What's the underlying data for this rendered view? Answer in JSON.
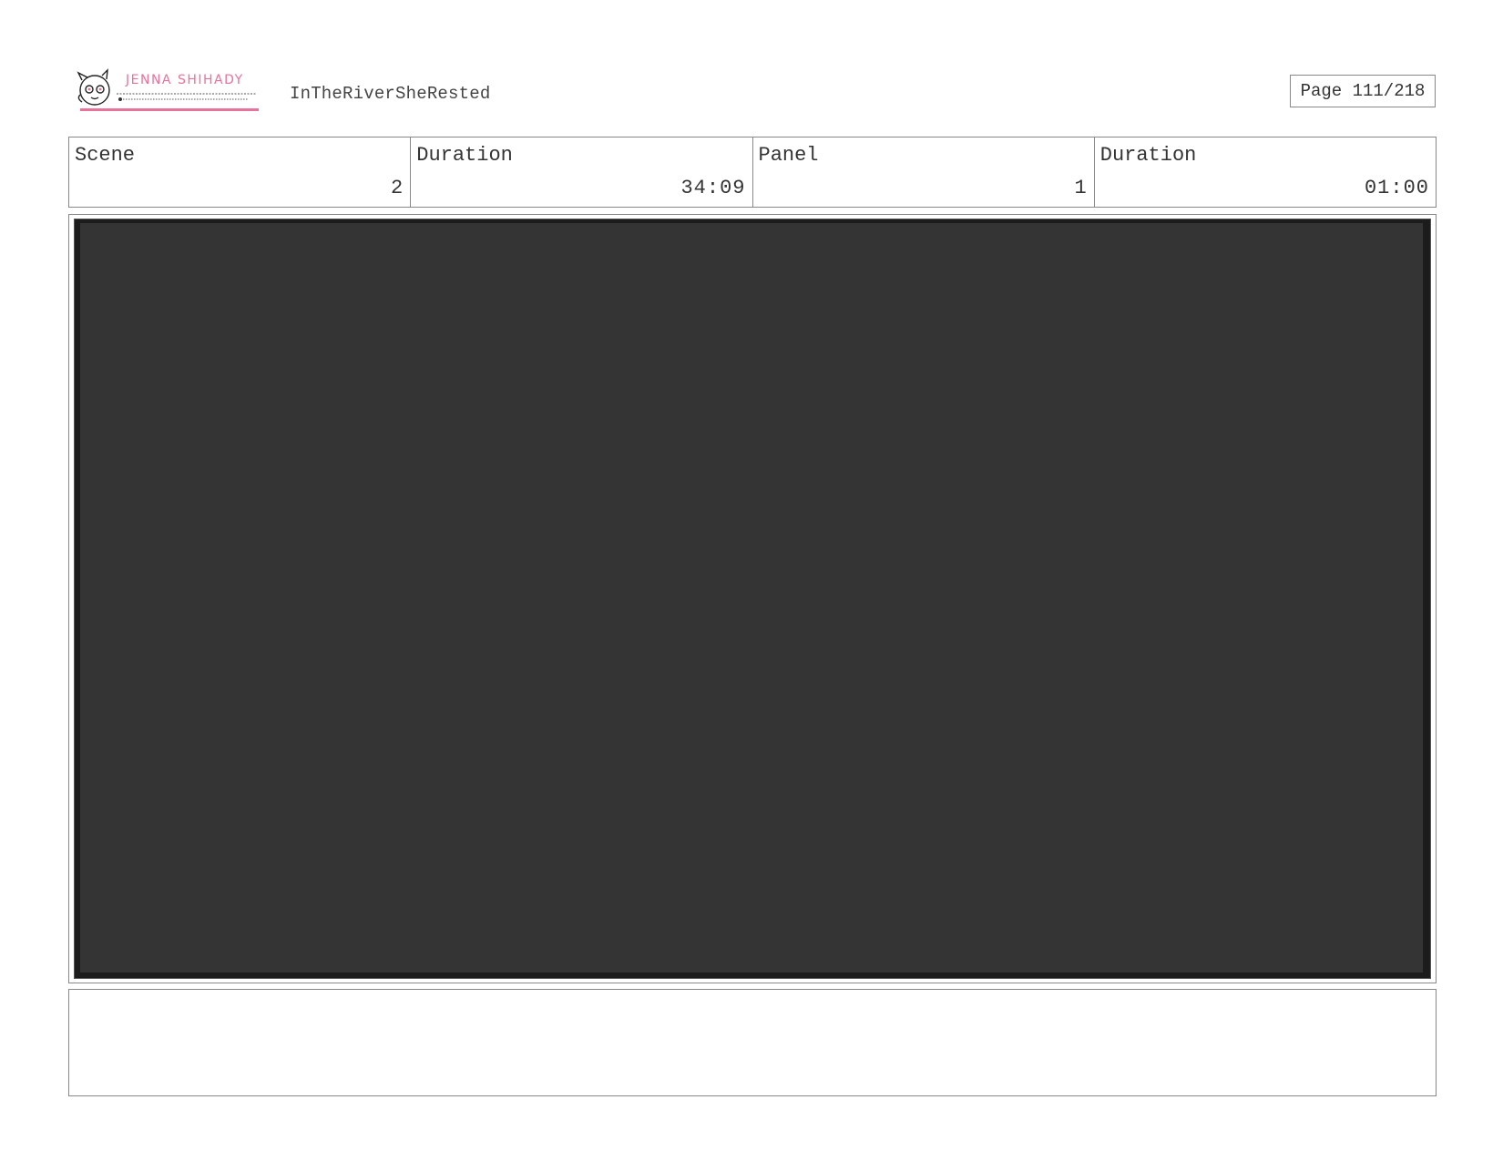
{
  "header": {
    "logo_text": "JENNA SHIHADY",
    "project_title": "InTheRiverSheRested",
    "page_label": "Page 111/218"
  },
  "info": [
    {
      "label": "Scene",
      "value": "2"
    },
    {
      "label": "Duration",
      "value": "34:09"
    },
    {
      "label": "Panel",
      "value": "1"
    },
    {
      "label": "Duration",
      "value": "01:00"
    }
  ],
  "colors": {
    "brand_pink": "#e8729b",
    "panel_fill": "#343434"
  },
  "notes": ""
}
